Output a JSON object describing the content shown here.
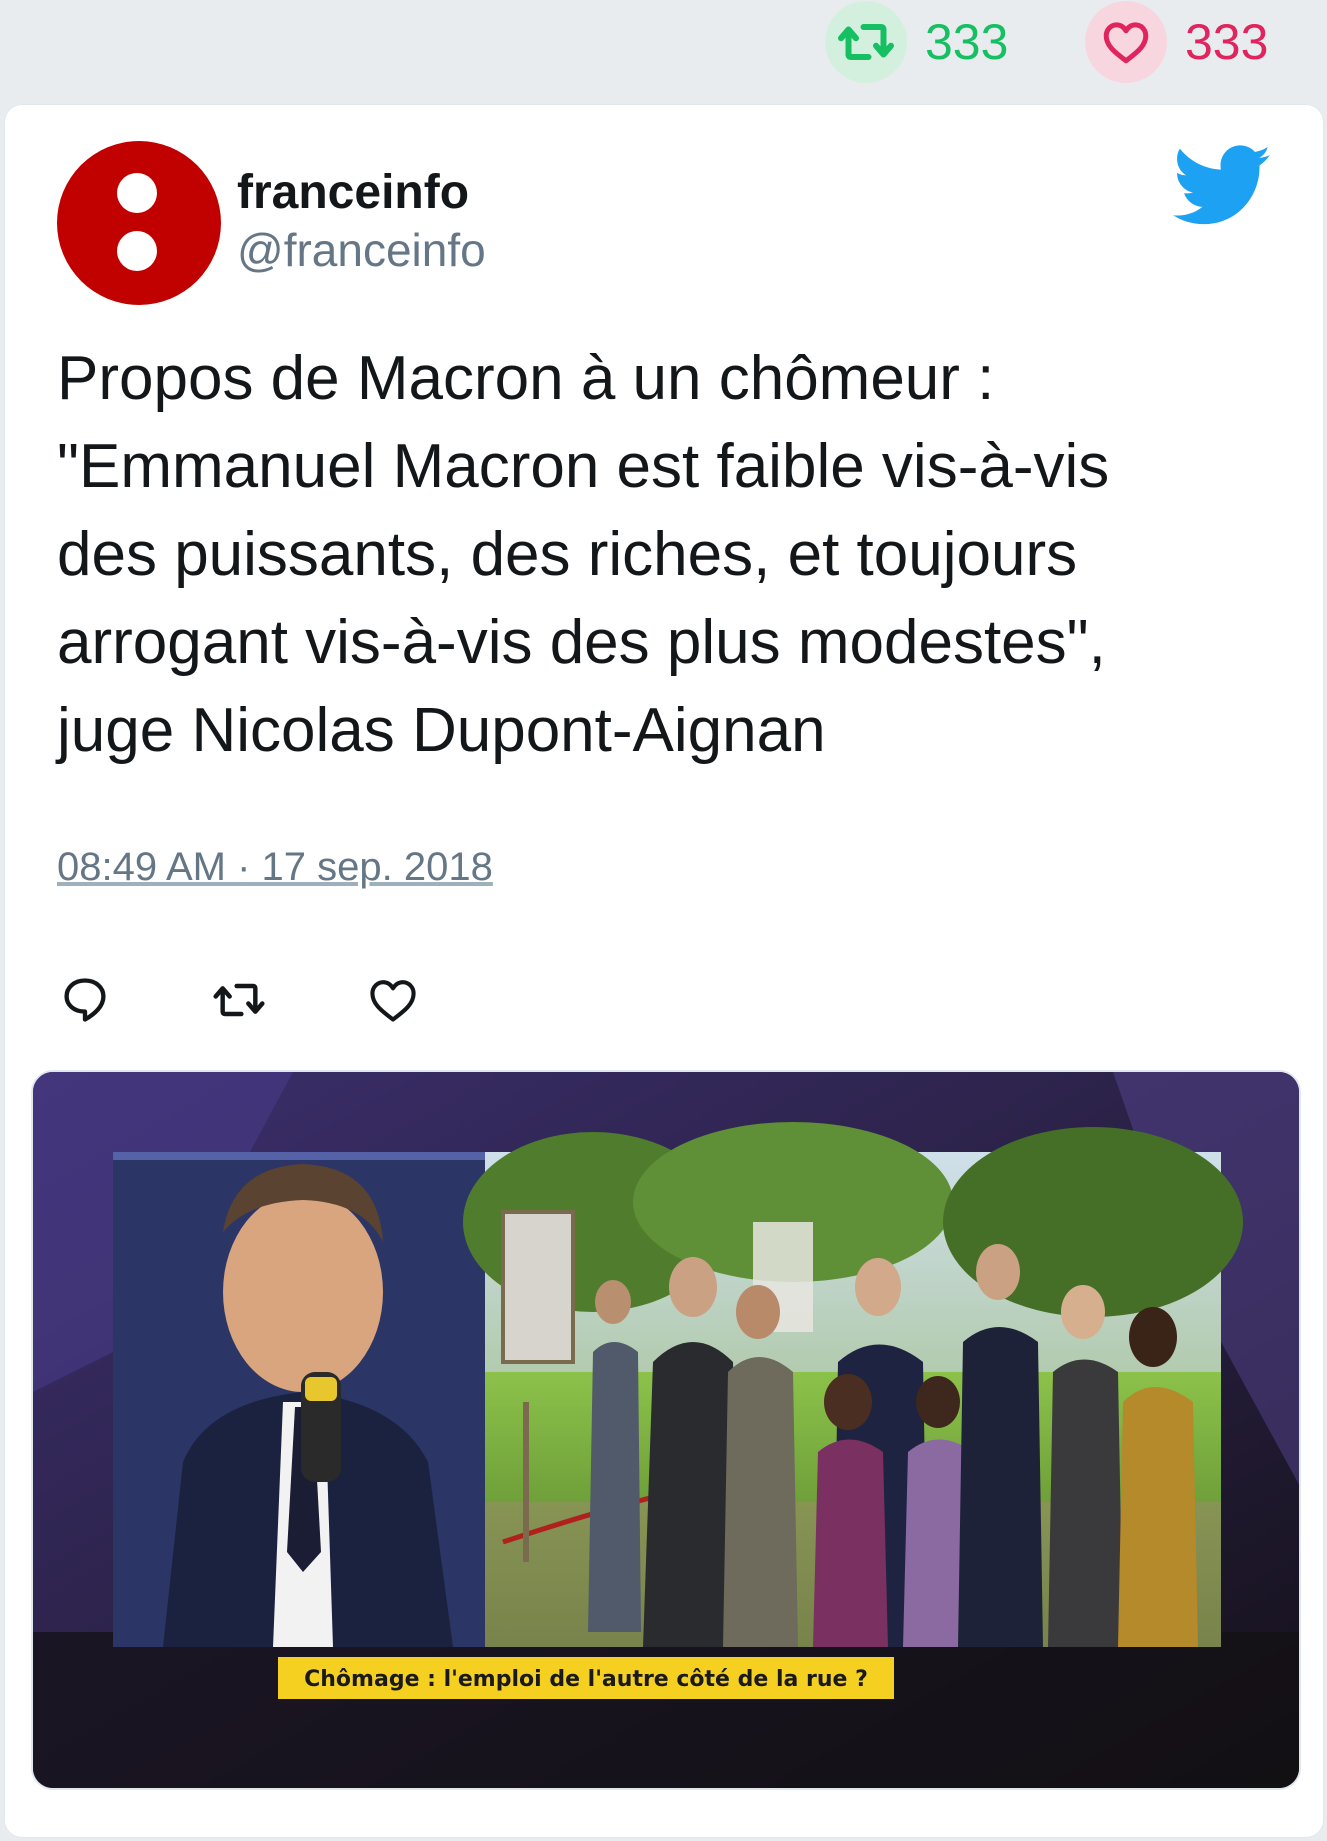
{
  "top_stats": {
    "retweets": "333",
    "likes": "333",
    "retweet_icon": "retweet-icon",
    "like_icon": "heart-icon"
  },
  "tweet": {
    "author_name": "franceinfo",
    "author_handle": "@franceinfo",
    "text_lines": [
      "Propos de Macron à un chômeur :",
      "\"Emmanuel Macron est faible vis-à-vis",
      "des puissants, des riches, et toujours",
      "arrogant vis-à-vis des plus modestes\",",
      "juge Nicolas Dupont-Aignan"
    ],
    "timestamp": "08:49 AM · 17 sep. 2018",
    "media_caption": "Chômage : l'emploi de l'autre côté de la rue ?"
  },
  "colors": {
    "retweet": "#17bf63",
    "like": "#e0245e",
    "twitter_blue": "#1da1f2",
    "avatar_red": "#c10000",
    "caption_yellow": "#f5d020"
  }
}
